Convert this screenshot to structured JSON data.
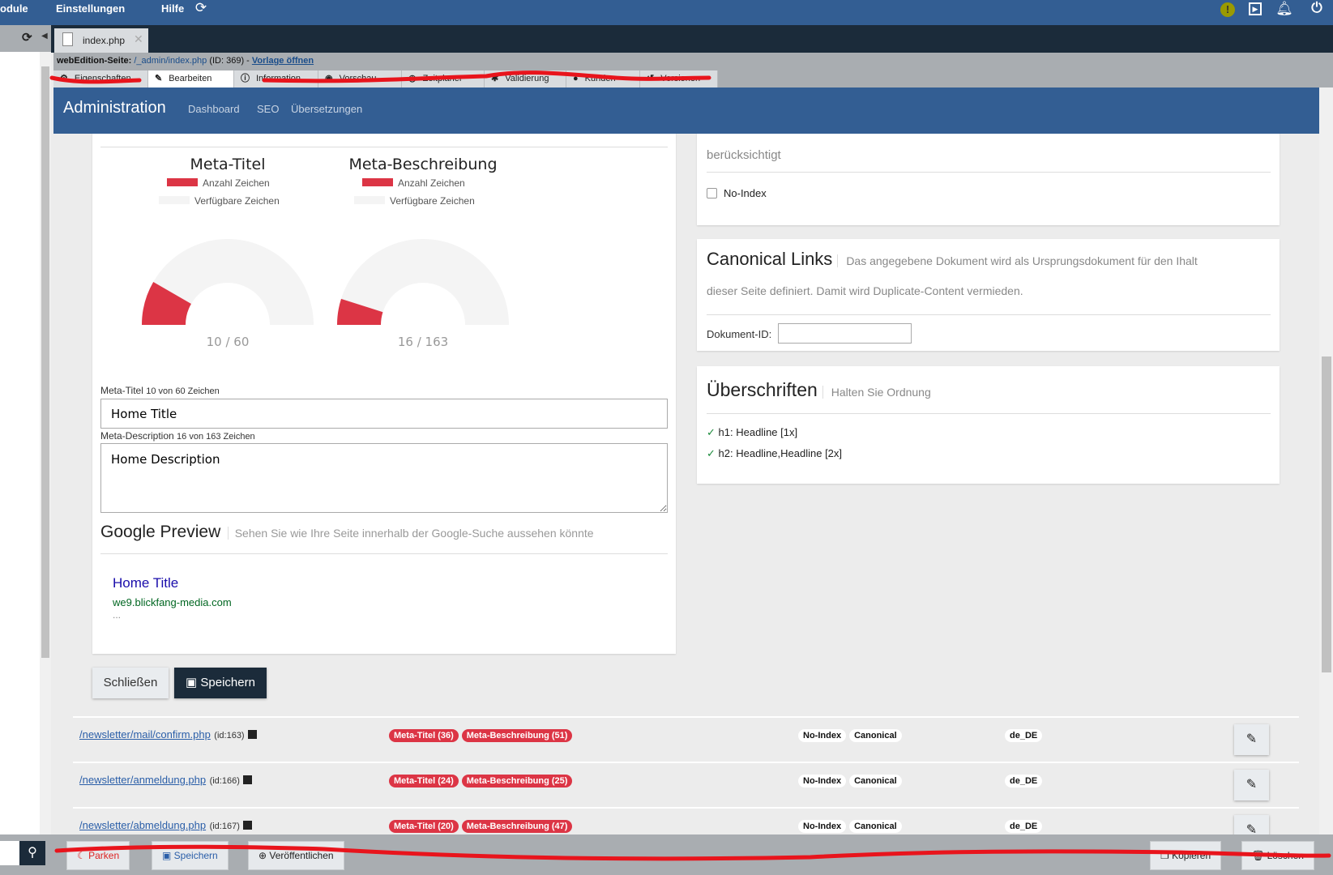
{
  "topmenu": {
    "items": [
      "odule",
      "Einstellungen",
      "Hilfe"
    ],
    "icons": [
      "refresh-icon",
      "warning-icon",
      "preview-icon",
      "bell-icon",
      "power-icon"
    ]
  },
  "doc_tab": {
    "label": "index.php"
  },
  "info": {
    "prefix": "webEdition-Seite:",
    "path": "/_admin/index.php",
    "id": "(ID: 369) -",
    "link": "Vorlage öffnen"
  },
  "edit_tabs": [
    "Eigenschaften",
    "Bearbeiten",
    "Information",
    "Vorschau",
    "Zeitplaner",
    "Validierung",
    "Kunden",
    "Versionen"
  ],
  "admin": {
    "title": "Administration",
    "nav": [
      "Dashboard",
      "SEO",
      "Übersetzungen"
    ]
  },
  "gauges": [
    {
      "title": "Meta-Titel",
      "legend_used": "Anzahl Zeichen",
      "legend_free": "Verfügbare Zeichen",
      "value": 10,
      "max": 60,
      "label": "10 / 60"
    },
    {
      "title": "Meta-Beschreibung",
      "legend_used": "Anzahl Zeichen",
      "legend_free": "Verfügbare Zeichen",
      "value": 16,
      "max": 163,
      "label": "16 / 163"
    }
  ],
  "colors": {
    "used": "#dc3545",
    "free": "#f4f4f4",
    "brand": "#335e93"
  },
  "form": {
    "title_label": "Meta-Titel",
    "title_count": "10 von 60 Zeichen",
    "title_value": "Home Title",
    "desc_label": "Meta-Description",
    "desc_count": "16 von 163 Zeichen",
    "desc_value": "Home Description"
  },
  "google": {
    "heading": "Google Preview",
    "sub": "Sehen Sie wie Ihre Seite innerhalb der Google-Suche aussehen könnte",
    "title": "Home Title",
    "url": "we9.blickfang-media.com",
    "desc": "..."
  },
  "buttons": {
    "close": "Schließen",
    "save": "Speichern"
  },
  "index_card": {
    "text": "berücksichtigt",
    "noindex": "No-Index"
  },
  "canonical": {
    "heading": "Canonical Links",
    "sub": "Das angegebene Dokument wird als Ursprungsdokument für den Ihalt",
    "sub2": "dieser Seite definiert. Damit wird Duplicate-Content vermieden.",
    "field_label": "Dokument-ID:",
    "field_value": ""
  },
  "headings": {
    "heading": "Überschriften",
    "sub": "Halten Sie Ordnung",
    "items": [
      "h1: Headline [1x]",
      "h2: Headline,Headline [2x]"
    ]
  },
  "rows": [
    {
      "path": "/newsletter/mail/confirm.php",
      "id": "(id:163)",
      "b1": "Meta-Titel (36)",
      "b2": "Meta-Beschreibung (51)",
      "t1": "No-Index",
      "t2": "Canonical",
      "lang": "de_DE"
    },
    {
      "path": "/newsletter/anmeldung.php",
      "id": "(id:166)",
      "b1": "Meta-Titel (24)",
      "b2": "Meta-Beschreibung (25)",
      "t1": "No-Index",
      "t2": "Canonical",
      "lang": "de_DE"
    },
    {
      "path": "/newsletter/abmeldung.php",
      "id": "(id:167)",
      "b1": "Meta-Titel (20)",
      "b2": "Meta-Beschreibung (47)",
      "t1": "No-Index",
      "t2": "Canonical",
      "lang": "de_DE"
    }
  ],
  "bottom": {
    "park": "Parken",
    "save": "Speichern",
    "publish": "Veröffentlichen",
    "copy": "Kopieren",
    "delete": "Löschen"
  }
}
